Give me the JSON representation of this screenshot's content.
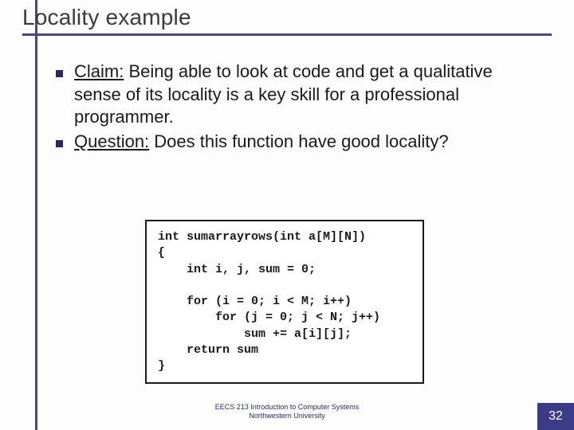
{
  "title": "Locality example",
  "bullets": [
    {
      "label": "Claim:",
      "rest": " Being able to look at code and get a qualitative sense of its locality is a key skill for a professional programmer."
    },
    {
      "label": "Question:",
      "rest": " Does this function have good locality?"
    }
  ],
  "code": "int sumarrayrows(int a[M][N])\n{\n    int i, j, sum = 0;\n\n    for (i = 0; i < M; i++)\n        for (j = 0; j < N; j++)\n            sum += a[i][j];\n    return sum\n}",
  "footer": {
    "line1": "EECS 213 Introduction to Computer Systems",
    "line2": "Northwestern University"
  },
  "page_number": "32"
}
